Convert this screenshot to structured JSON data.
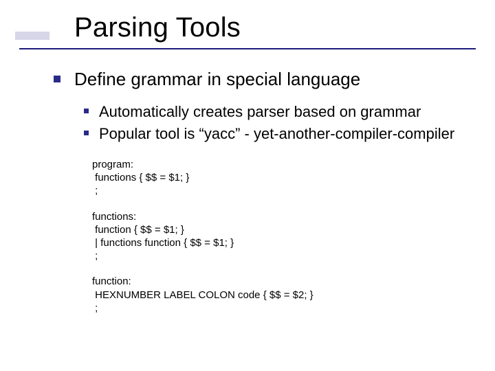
{
  "title": "Parsing Tools",
  "level1": {
    "text": "Define grammar in special language"
  },
  "level2": [
    {
      "text": "Automatically creates parser based on grammar"
    },
    {
      "text": "Popular tool is “yacc” - yet-another-compiler-compiler"
    }
  ],
  "code_segments": [
    [
      "program:",
      " functions { $$ = $1; }",
      " ;"
    ],
    [
      "functions:",
      " function { $$ = $1; }",
      " | functions function { $$ = $1; }",
      " ;"
    ],
    [
      "function:",
      " HEXNUMBER LABEL COLON code { $$ = $2; }",
      " ;"
    ]
  ]
}
